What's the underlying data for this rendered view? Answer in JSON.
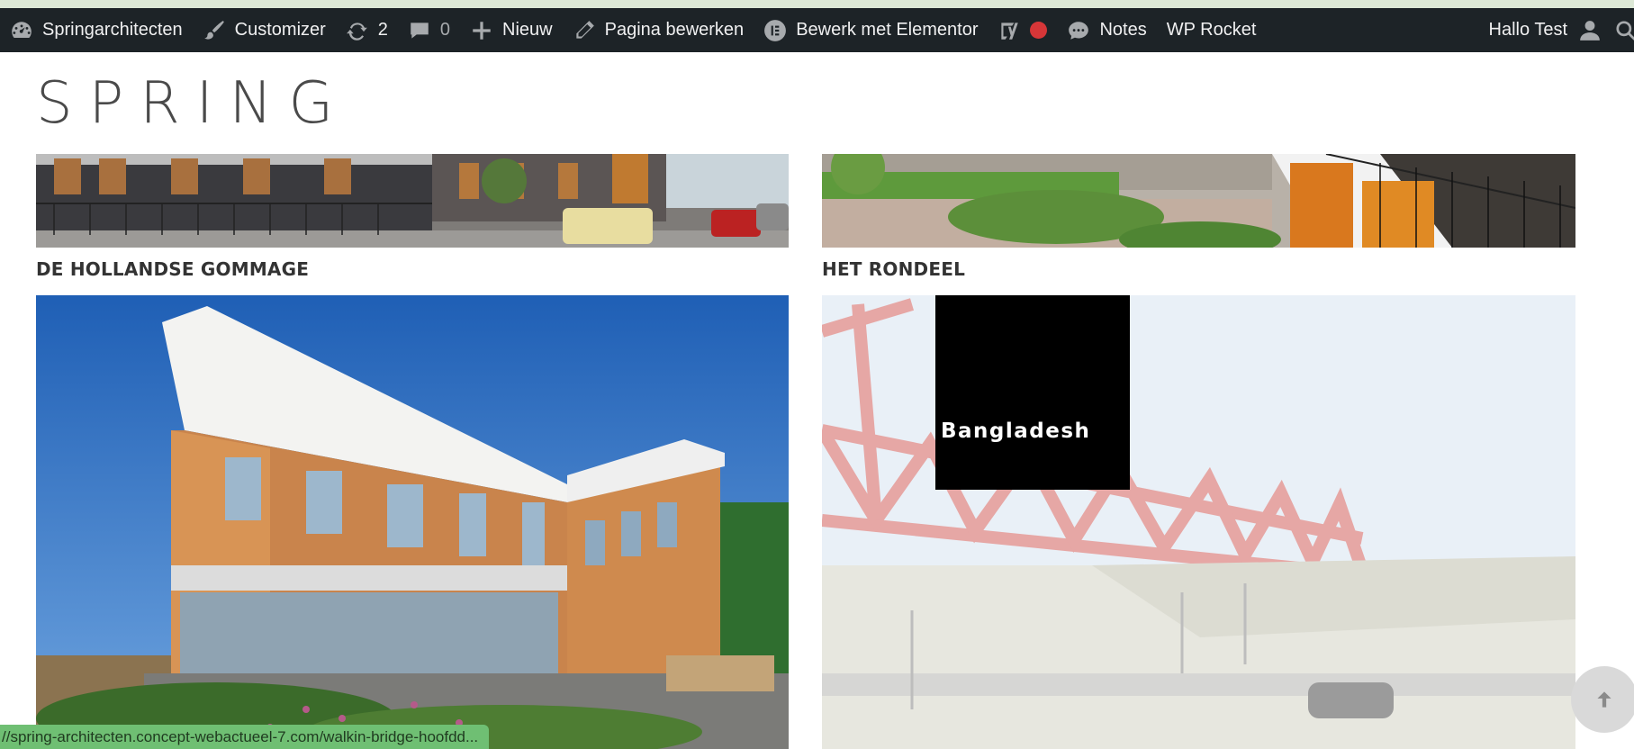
{
  "adminbar": {
    "site_name": "Springarchitecten",
    "customizer": "Customizer",
    "updates_count": "2",
    "comments_count": "0",
    "new_label": "Nieuw",
    "edit_page": "Pagina bewerken",
    "elementor": "Bewerk met Elementor",
    "notes": "Notes",
    "wp_rocket": "WP Rocket",
    "greeting": "Hallo Test"
  },
  "site": {
    "logo": "SPRING",
    "projects": [
      {
        "title": "DE HOLLANDSE GOMMAGE"
      },
      {
        "title": "HET RONDEEL"
      }
    ],
    "hover_overlay_text": "Bangladesh"
  },
  "statusbar": {
    "url": "//spring-architecten.concept-webactueel-7.com/walkin-bridge-hoofdd..."
  },
  "colors": {
    "adminbar_bg": "#1d2327",
    "statusbar_bg": "#6fbf73",
    "overlay_bg": "#000000"
  }
}
